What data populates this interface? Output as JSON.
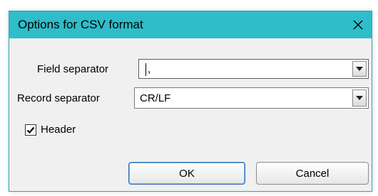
{
  "dialog": {
    "title": "Options for CSV format",
    "close_icon": "close-icon"
  },
  "field_separator": {
    "label": "Field separator",
    "value": ","
  },
  "record_separator": {
    "label": "Record separator",
    "value": "CR/LF"
  },
  "header": {
    "label": "Header",
    "checked": true
  },
  "buttons": {
    "ok_label": "OK",
    "cancel_label": "Cancel"
  },
  "colors": {
    "titlebar": "#2ebdc9",
    "dialog_bg": "#f0f0f0"
  }
}
